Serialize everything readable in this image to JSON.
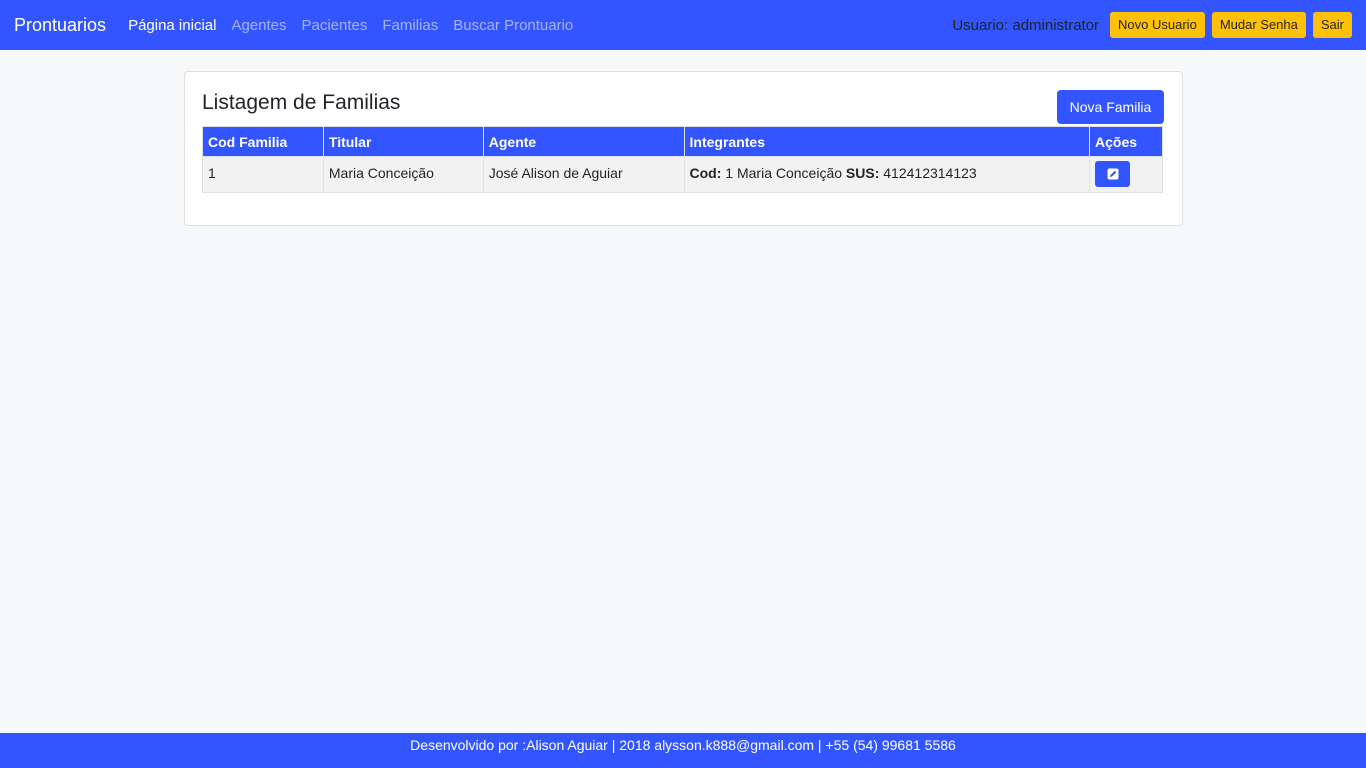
{
  "navbar": {
    "brand": "Prontuarios",
    "links": [
      {
        "label": "Página inicial",
        "active": true
      },
      {
        "label": "Agentes",
        "active": false
      },
      {
        "label": "Pacientes",
        "active": false
      },
      {
        "label": "Familias",
        "active": false
      },
      {
        "label": "Buscar Prontuario",
        "active": false
      }
    ],
    "user_label": "Usuario: administrator",
    "new_user_label": "Novo Usuario",
    "change_password_label": "Mudar Senha",
    "logout_label": "Sair"
  },
  "main": {
    "title": "Listagem de Familias",
    "new_family_label": "Nova Familia",
    "columns": [
      "Cod Familia",
      "Titular",
      "Agente",
      "Integrantes",
      "Ações"
    ],
    "rows": [
      {
        "cod": "1",
        "titular": "Maria Conceição",
        "agente": "José Alison de Aguiar",
        "integrantes": {
          "cod_label": "Cod:",
          "cod_value": "1 Maria Conceição",
          "sus_label": "SUS:",
          "sus_value": "412412314123"
        }
      }
    ]
  },
  "footer": {
    "text": "Desenvolvido por :Alison Aguiar | 2018 alysson.k888@gmail.com | +55 (54) 99681 5586"
  },
  "colors": {
    "primary": "#3355ff",
    "warning": "#ffc107",
    "background": "#f7f8fa"
  }
}
